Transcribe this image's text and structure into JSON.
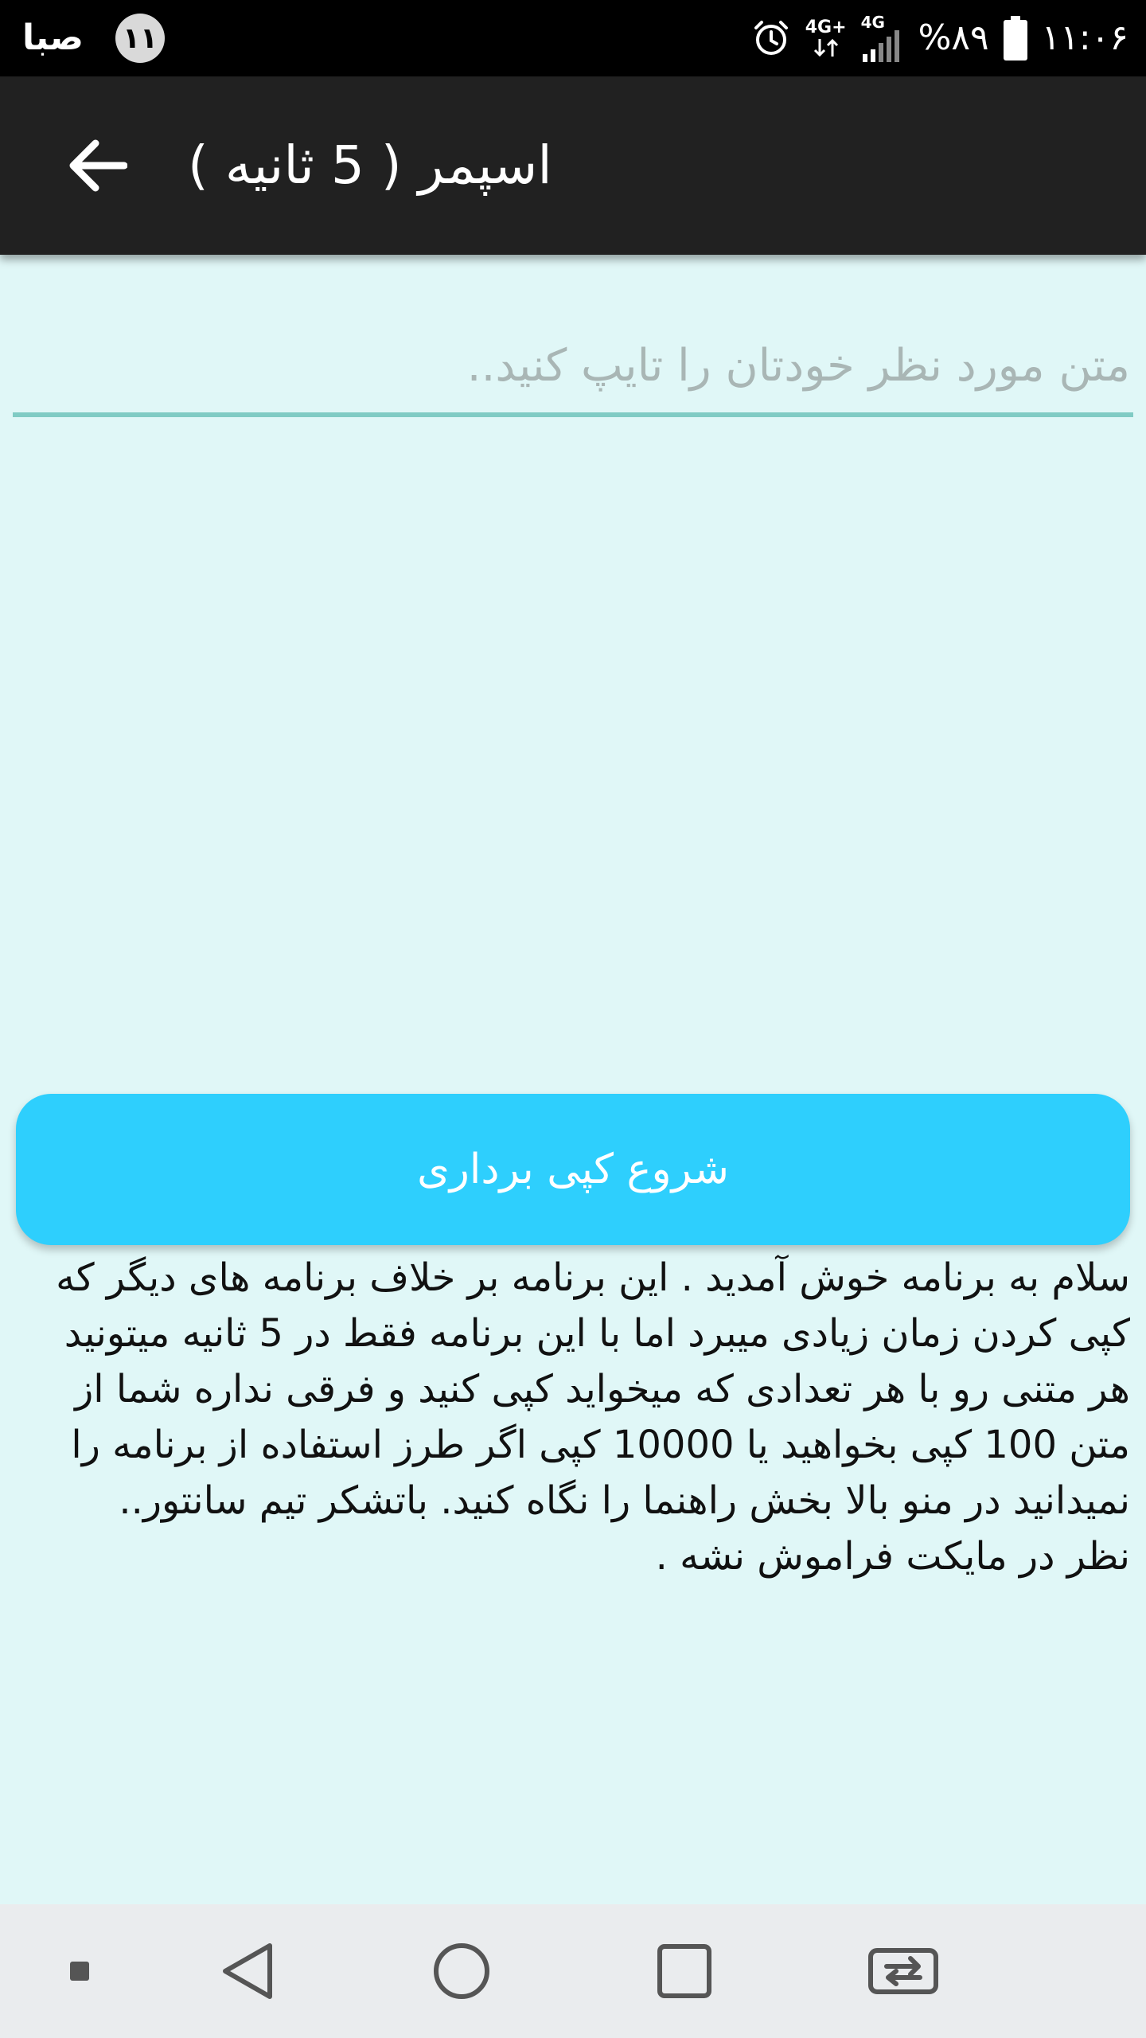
{
  "status_bar": {
    "app_mark": "صبا",
    "notification_count": "۱۱",
    "network_label": "4G+",
    "signal_label": "4G",
    "battery_percent": "%۸۹",
    "time": "۱۱:۰۶"
  },
  "app_bar": {
    "title": "اسپمر ( 5 ثانیه )"
  },
  "input": {
    "placeholder": "متن مورد نظر خودتان را تایپ کنید..",
    "value": ""
  },
  "start_button": {
    "label": "شروع کپی برداری"
  },
  "description": {
    "text": "سلام به برنامه خوش آمدید . این برنامه بر خلاف برنامه های دیگر که کپی کردن زمان زیادی میبرد اما با این برنامه فقط در 5 ثانیه میتونید هر متنی رو با هر تعدادی که میخواید کپی کنید و فرقی نداره شما از متن 100 کپی بخواهید یا 10000 کپی اگر طرز استفاده از برنامه را نمیدانید در منو بالا بخش راهنما را نگاه کنید. باتشکر تیم سانتور.. نظر در مایکت فراموش نشه ."
  },
  "icons": {
    "back": "arrow-left-icon",
    "alarm": "alarm-icon",
    "battery": "battery-icon",
    "nav_square": "small-square-icon",
    "nav_back": "triangle-back-icon",
    "nav_home": "circle-home-icon",
    "nav_recents": "square-recents-icon",
    "nav_switch": "switch-apps-icon"
  },
  "colors": {
    "status_bar": "#000000",
    "app_bar": "#212121",
    "background": "#e0f7f7",
    "input_underline": "#80cbc4",
    "button": "#2ecffd",
    "nav_bar": "#eaecee"
  }
}
